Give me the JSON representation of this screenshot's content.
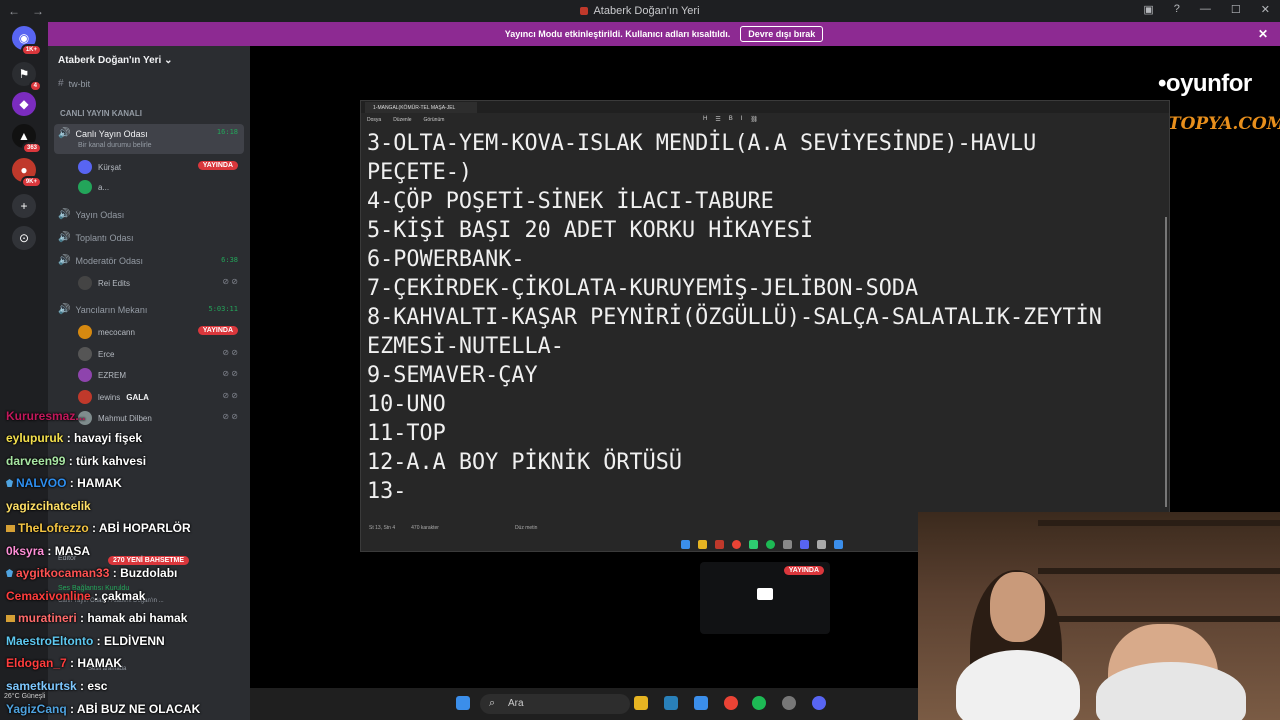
{
  "window": {
    "title": "Ataberk Doğan'ın Yeri",
    "nav_back": "←",
    "nav_fwd": "→"
  },
  "banner": {
    "text": "Yayıncı Modu etkinleştirildi. Kullanıcı adları kısaltıldı.",
    "button": "Devre dışı bırak",
    "close": "✕"
  },
  "rail": {
    "badges": [
      "1K+",
      "4",
      "363",
      "9K+"
    ]
  },
  "sidebar": {
    "server_name": "Ataberk Doğan'ın Yeri",
    "top_channel": "tw-bit",
    "category_live": "CANLI YAYIN KANALI",
    "live_channel": "Canlı Yayın Odası",
    "live_channel_status": "Bir kanal durumu belirle",
    "live_timer": "16:18",
    "live_users": [
      {
        "name": "Kürşat",
        "badge": "YAYINDA"
      },
      {
        "name": "a..."
      }
    ],
    "channels": [
      {
        "name": "Yayın Odası"
      },
      {
        "name": "Toplantı Odası"
      },
      {
        "name": "Moderatör Odası",
        "timer": "6:38"
      }
    ],
    "mod_users": [
      "Rei Edits"
    ],
    "mekan": {
      "name": "Yancıların Mekanı",
      "timer": "5:03:11"
    },
    "mekan_users": [
      {
        "name": "mecocann",
        "badge": "YAYINDA"
      },
      {
        "name": "Erce"
      },
      {
        "name": "EZREM"
      },
      {
        "name": "lewins",
        "tag": "GALA"
      },
      {
        "name": "Mahmut Dilben"
      }
    ],
    "editor_label": "Editör",
    "promo": "270 YENİ BAHSETME",
    "voice_connected": "Ses Bağlantısı Kuruldu",
    "voice_path": "Canlı Yayın Odası / Ataberk Doğan'ın ...",
    "user_status": "Sesli aramada"
  },
  "notepad": {
    "tab": "1-MANGAL(KÖMÜR-TEL MAŞA-JEL",
    "menu": [
      "Dosya",
      "Düzenle",
      "Görünüm"
    ],
    "lines": [
      "3-OLTA-YEM-KOVA-ISLAK MENDİL(A.A SEVİYESİNDE)-HAVLU",
      "PEÇETE-)",
      "4-ÇÖP POŞETİ-SİNEK İLACI-TABURE",
      "5-KİŞİ BAŞI 20 ADET KORKU HİKAYESİ",
      "6-POWERBANK-",
      "7-ÇEKİRDEK-ÇİKOLATA-KURUYEMİŞ-JELİBON-SODA",
      "8-KAHVALTI-KAŞAR PEYNİRİ(ÖZGÜLLÜ)-SALÇA-SALATALIK-ZEYTİN",
      "EZMESİ-NUTELLA-",
      "9-SEMAVER-ÇAY",
      "10-UNO",
      "11-TOP",
      "12-A.A BOY PİKNİK ÖRTÜSÜ",
      "13-"
    ],
    "status": [
      "St 13, Stn 4",
      "470 karakter",
      "Düz metin"
    ]
  },
  "share": {
    "badge": "YAYINDA"
  },
  "logo": {
    "line1": "•oyunfor",
    "line2": "ITOPYA.COM"
  },
  "chat": [
    {
      "user": "Kururesmaz...",
      "text": "",
      "color": "#c2185b"
    },
    {
      "user": "eylupuruk",
      "text": "havayi fişek",
      "color": "#f4e04d"
    },
    {
      "user": "darveen99",
      "text": "türk kahvesi",
      "color": "#a8e6a3"
    },
    {
      "user": "NALVOO",
      "text": "HAMAK",
      "color": "#2e8ff0",
      "gem": true
    },
    {
      "user": "yagizcihatcelik",
      "text": "",
      "color": "#ffe066"
    },
    {
      "user": "TheLofrezzo",
      "text": "ABİ HOPARLÖR",
      "color": "#f4c542",
      "crown": true
    },
    {
      "user": "0ksyra",
      "text": "MASA",
      "color": "#ff8fd8"
    },
    {
      "user": "aygitkocaman33",
      "text": "Buzdolabı",
      "color": "#ff5252",
      "gem": true
    },
    {
      "user": "Cemaxivonline",
      "text": "çakmak",
      "color": "#ff3d3d"
    },
    {
      "user": "muratineri",
      "text": "hamak abi hamak",
      "color": "#ff6b6b",
      "crown": true
    },
    {
      "user": "MaestroEltonto",
      "text": "ELDİVENN",
      "color": "#5ec8f0"
    },
    {
      "user": "Eldogan_7",
      "text": "HAMAK",
      "color": "#ff3d3d"
    },
    {
      "user": "sametkurtsk",
      "text": "esc",
      "color": "#7ec8ff"
    },
    {
      "user": "YagizCanq",
      "text": "ABİ BUZ NE OLACAK",
      "color": "#4fa3e0"
    }
  ],
  "weather": {
    "temp": "26°C",
    "desc": "Güneşli"
  },
  "taskbar": {
    "search": "Ara"
  }
}
